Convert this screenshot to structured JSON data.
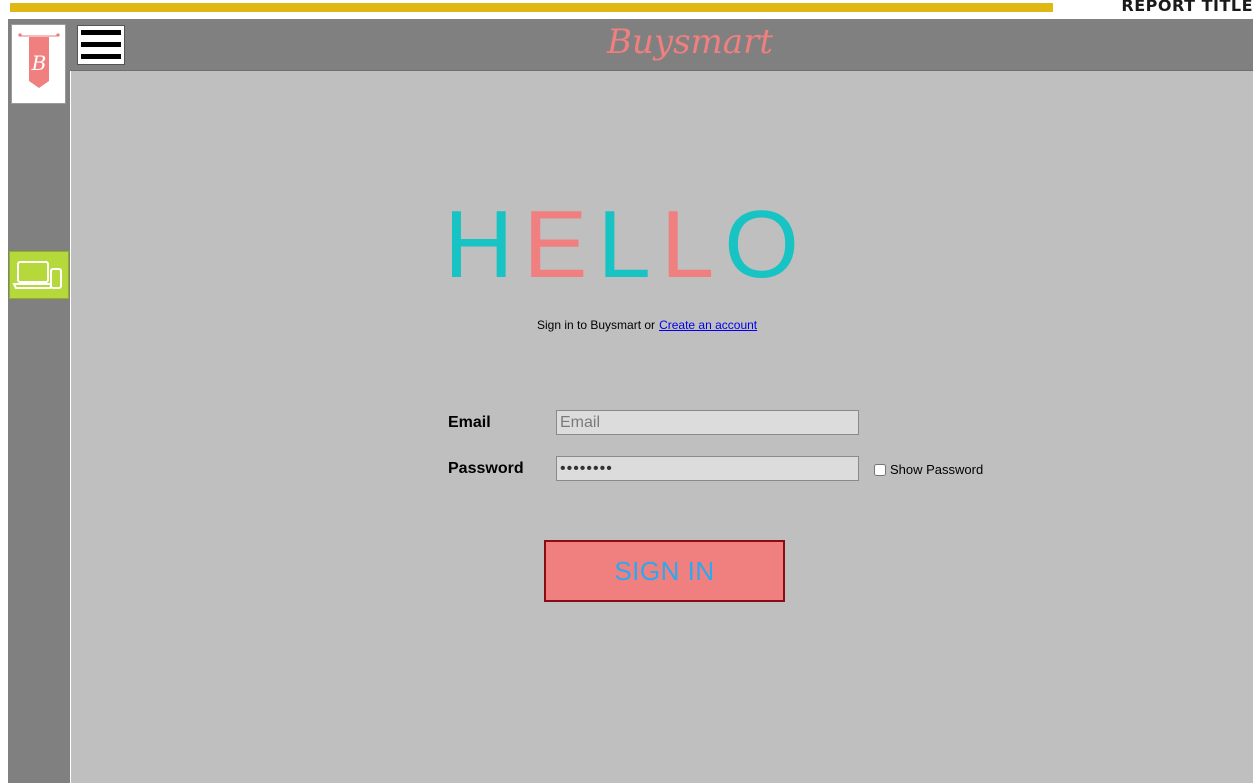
{
  "report": {
    "title": "REPORT TITLE"
  },
  "header": {
    "brand": "Buysmart"
  },
  "logo": {
    "letter": "B"
  },
  "hello": [
    {
      "char": "H",
      "color": "#17c3c3"
    },
    {
      "char": "E",
      "color": "#f08080"
    },
    {
      "char": "L",
      "color": "#17c3c3"
    },
    {
      "char": "L",
      "color": "#f08080"
    },
    {
      "char": "O",
      "color": "#17c3c3"
    }
  ],
  "intro": {
    "text": "Sign in to Buysmart or",
    "link": "Create an account"
  },
  "form": {
    "email_label": "Email",
    "email_placeholder": "Email",
    "email_value": "",
    "password_label": "Password",
    "password_value": "••••••••",
    "show_password": "Show Password",
    "signin": "SIGN IN"
  },
  "colors": {
    "accent_teal": "#17c3c3",
    "accent_pink": "#f08080",
    "rail": "#808080",
    "content": "#bfbfbf",
    "device_button": "#b5d93a"
  }
}
